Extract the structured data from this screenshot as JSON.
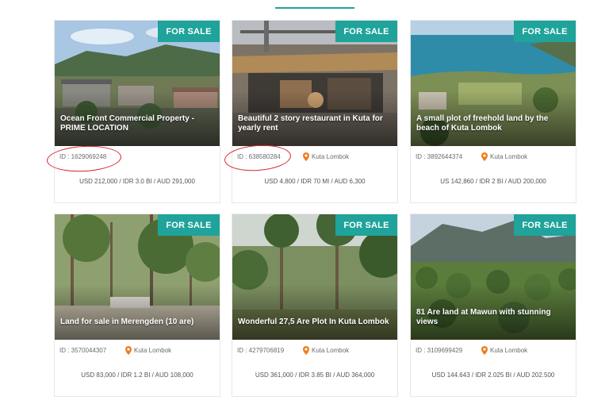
{
  "accent_color": "#1fa39a",
  "listings": [
    {
      "badge": "FOR SALE",
      "title": "Ocean Front Commercial Property - PRIME LOCATION",
      "id": "ID : 1629069248",
      "location": "",
      "price": "USD 212,000 / IDR 3.0 BI / AUD 291,000"
    },
    {
      "badge": "FOR SALE",
      "title": "Beautiful 2 story restaurant in Kuta for yearly rent",
      "id": "ID : 638580284",
      "location": "Kuta Lombok",
      "price": "USD 4,800 / IDR 70 MI / AUD 6,300"
    },
    {
      "badge": "FOR SALE",
      "title": "A small plot of freehold land by the beach of Kuta Lombok",
      "id": "ID : 3892644374",
      "location": "Kuta Lombok",
      "price": "US 142,860 / IDR 2 BI / AUD 200,000"
    },
    {
      "badge": "FOR SALE",
      "title": "Land for sale in Merengden (10 are)",
      "id": "ID : 3570044307",
      "location": "Kuta Lombok",
      "price": "USD 83,000 / IDR 1.2 BI / AUD 108,000"
    },
    {
      "badge": "FOR SALE",
      "title": "Wonderful 27,5 Are Plot In Kuta Lombok",
      "id": "ID : 4279706819",
      "location": "Kuta Lombok",
      "price": "USD 361,000 / IDR 3.85 BI / AUD 364,000"
    },
    {
      "badge": "FOR SALE",
      "title": "81 Are land at Mawun with stunning views",
      "id": "ID : 3109699429",
      "location": "Kuta Lombok",
      "price": "USD 144.643 / IDR 2.025 BI / AUD 202.500"
    }
  ]
}
